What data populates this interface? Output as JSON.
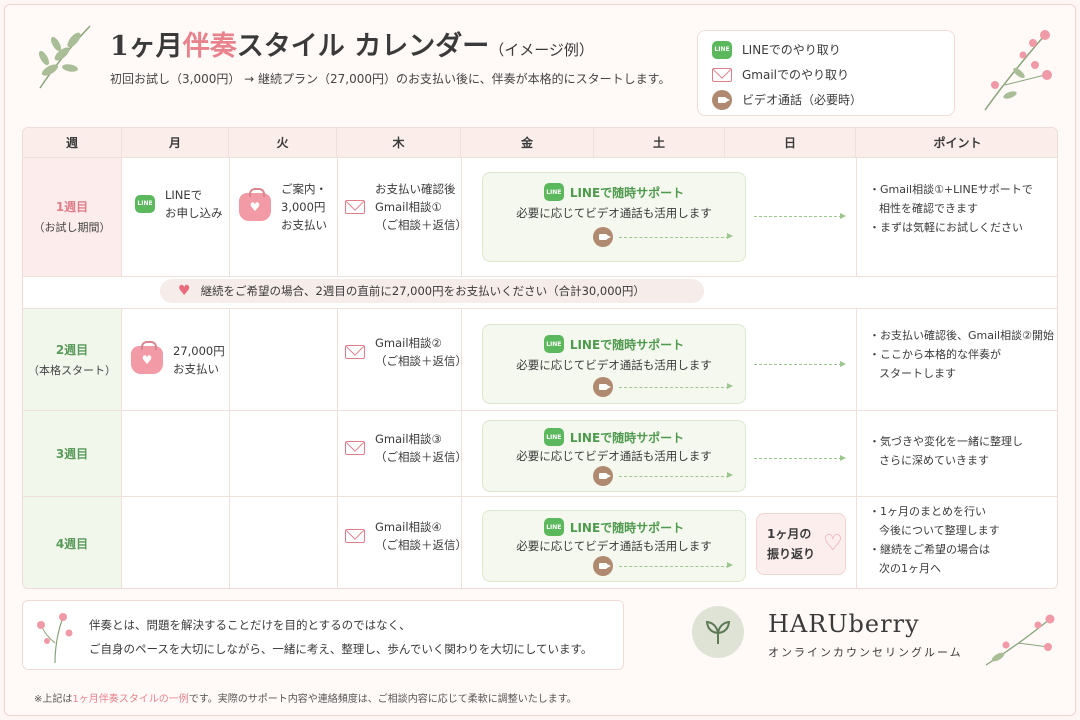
{
  "header": {
    "title_a": "1ヶ月",
    "title_b": "伴奏",
    "title_c": "スタイル カレンダー",
    "title_d": "（イメージ例）",
    "subtitle": "初回お試し（3,000円） →  継続プラン（27,000円）のお支払い後に、伴奏が本格的にスタートします。"
  },
  "legend": [
    {
      "icon": "line-icon",
      "label": "LINEでのやり取り"
    },
    {
      "icon": "mail-icon",
      "label": "Gmailでのやり取り"
    },
    {
      "icon": "video-icon",
      "label": "ビデオ通話（必要時）"
    }
  ],
  "columns": [
    "週",
    "月",
    "火",
    "木",
    "金",
    "土",
    "日",
    "ポイント"
  ],
  "weeks": [
    {
      "label": "1週目",
      "sub": "（お試し期間）"
    },
    {
      "label": "2週目",
      "sub": "（本格スタート）"
    },
    {
      "label": "3週目",
      "sub": ""
    },
    {
      "label": "4週目",
      "sub": ""
    }
  ],
  "cells": {
    "w1_mon": [
      "LINEで",
      "お申し込み"
    ],
    "w1_tue": [
      "ご案内・",
      "3,000円",
      "お支払い"
    ],
    "w1_thu": [
      "お支払い確認後",
      "Gmail相談①",
      "（ご相談＋返信）"
    ],
    "w2_mon": [
      "27,000円",
      "お支払い"
    ],
    "w2_thu": [
      "Gmail相談②",
      "（ご相談＋返信）"
    ],
    "w3_thu": [
      "Gmail相談③",
      "（ご相談＋返信）"
    ],
    "w4_thu": [
      "Gmail相談④",
      "（ご相談＋返信）"
    ]
  },
  "support": {
    "title": "LINEで随時サポート",
    "sub": "必要に応じてビデオ通話も活用します"
  },
  "band": "継続をご希望の場合、2週目の直前に27,000円をお支払いください（合計30,000円）",
  "reflect": [
    "1ヶ月の",
    "振り返り"
  ],
  "points": [
    [
      "・Gmail相談①+LINEサポートで",
      "相性を確認できます",
      "・まずは気軽にお試しください"
    ],
    [
      "・お支払い確認後、Gmail相談②開始",
      "・ここから本格的な伴奏が",
      "スタートします"
    ],
    [
      "・気づきや変化を一緒に整理し",
      "さらに深めていきます"
    ],
    [
      "・1ヶ月のまとめを行い",
      "今後について整理します",
      "・継続をご希望の場合は",
      "次の1ヶ月へ"
    ]
  ],
  "bottom": {
    "line1": "伴奏とは、問題を解決することだけを目的とするのではなく、",
    "line2": "ご自身のペースを大切にしながら、一緒に考え、整理し、歩んでいく関わりを大切にしています。"
  },
  "brand": {
    "name": "HARUberry",
    "sub": "オンラインカウンセリングルーム"
  },
  "note": {
    "a": "※上記は",
    "b": "1ヶ月伴奏スタイルの一例",
    "c": "です。実際のサポート内容や連絡頻度は、ご相談内容に応じて柔軟に調整いたします。"
  },
  "colors": {
    "pink": "#e8838e",
    "green": "#5bb85d",
    "video": "#b08a70",
    "week_green": "#5a9a5a"
  }
}
